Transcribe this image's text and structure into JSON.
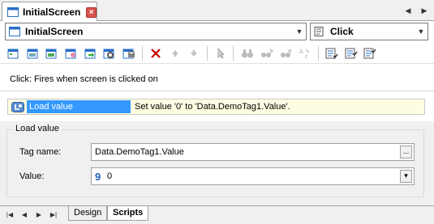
{
  "tabs": [
    {
      "label": "InitialScreen",
      "active": true
    }
  ],
  "screen_selector": {
    "value": "InitialScreen"
  },
  "event_selector": {
    "value": "Click"
  },
  "event_description": "Click: Fires when screen is clicked on",
  "action": {
    "name": "Load value",
    "description": "Set value '0' to 'Data.DemoTag1.Value'."
  },
  "properties": {
    "group_title": "Load value",
    "tag_name_label": "Tag name:",
    "tag_name_value": "Data.DemoTag1.Value",
    "value_label": "Value:",
    "value_type_glyph": "9",
    "value_value": "0",
    "browse_glyph": "...",
    "dropdown_glyph": "▾"
  },
  "bottom_tabs": [
    {
      "label": "Design",
      "active": false
    },
    {
      "label": "Scripts",
      "active": true
    }
  ],
  "colors": {
    "selection": "#3399ff",
    "action_row_bg": "#fffde1",
    "delete_icon": "#cc0000",
    "close_tab": "#d9534f"
  },
  "toolbar_icons": [
    "add-action-icon",
    "add-action-2-icon",
    "add-screen-action-icon",
    "add-tag-action-icon",
    "add-script-action-icon",
    "add-settings-action-icon",
    "add-print-action-icon",
    "delete-icon",
    "move-up-icon",
    "move-down-icon",
    "pointer-icon",
    "binoculars-icon",
    "find-next-icon",
    "find-prev-icon",
    "replace-icon",
    "list-check-icon",
    "list-check-2-icon",
    "list-check-3-icon"
  ]
}
